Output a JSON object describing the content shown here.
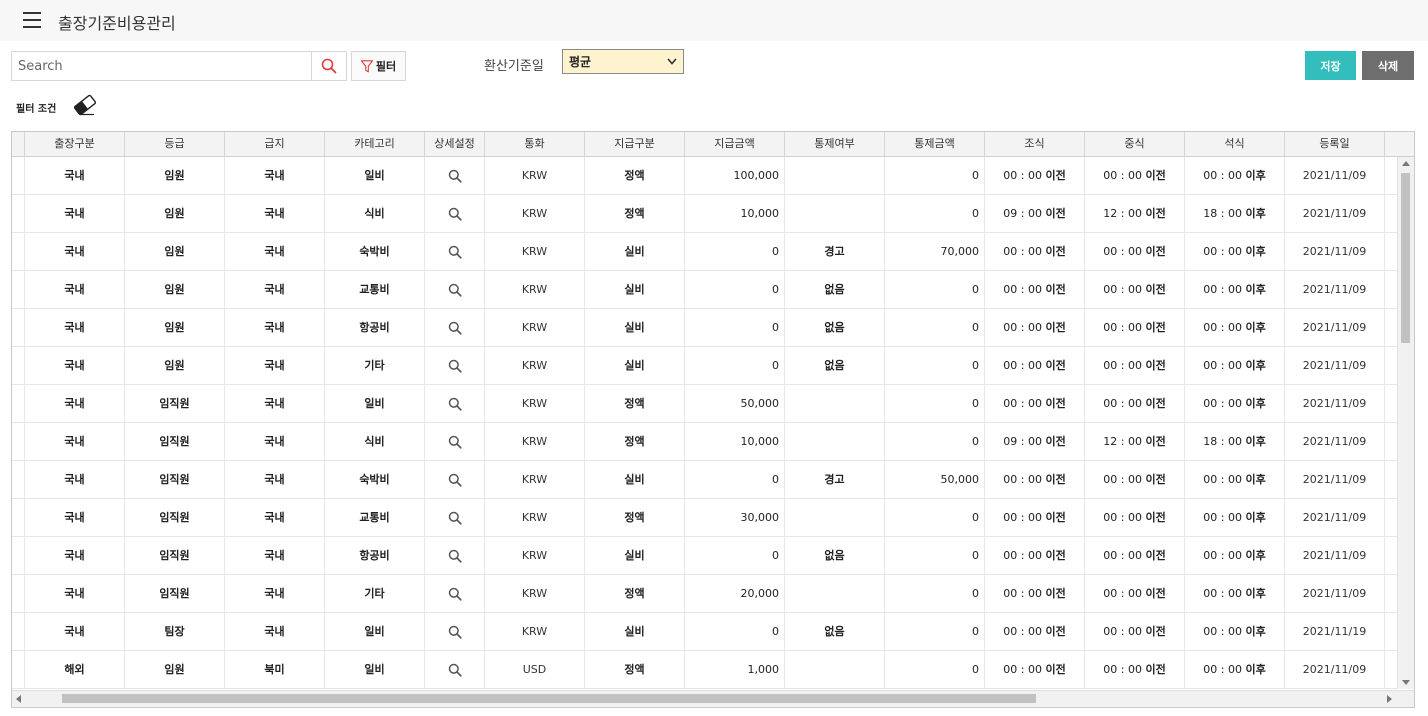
{
  "header": {
    "title": "출장기준비용관리"
  },
  "toolbar": {
    "search_placeholder": "Search",
    "filter_label": "필터",
    "conversion_label": "환산기준일",
    "conversion_value": "평균",
    "save_label": "저장",
    "delete_label": "삭제",
    "filter_condition_label": "필터 조건"
  },
  "colors": {
    "accent": "#34bdbd",
    "delete": "#6e6e6e",
    "select_bg": "#fdf3cf",
    "search_icon": "#e0393e",
    "filter_icon": "#e0393e"
  },
  "icons": {
    "menu": "hamburger-icon",
    "search": "search-icon",
    "filter": "funnel-icon",
    "eraser": "eraser-icon",
    "detail": "magnifier-icon"
  },
  "columns": [
    "출장구분",
    "등급",
    "급지",
    "카테고리",
    "상세설정",
    "통화",
    "지급구분",
    "지급금액",
    "통제여부",
    "통제금액",
    "조식",
    "중식",
    "석식",
    "등록일"
  ],
  "rows": [
    {
      "trip": "국내",
      "grade": "임원",
      "zone": "국내",
      "category": "일비",
      "currency": "KRW",
      "pay_type": "정액",
      "amount": "100,000",
      "control": "",
      "control_amount": "0",
      "breakfast": [
        "00 : 00",
        "이전"
      ],
      "lunch": [
        "00 : 00",
        "이전"
      ],
      "dinner": [
        "00 : 00",
        "이후"
      ],
      "date": "2021/11/09"
    },
    {
      "trip": "국내",
      "grade": "임원",
      "zone": "국내",
      "category": "식비",
      "currency": "KRW",
      "pay_type": "정액",
      "amount": "10,000",
      "control": "",
      "control_amount": "0",
      "breakfast": [
        "09 : 00",
        "이전"
      ],
      "lunch": [
        "12 : 00",
        "이전"
      ],
      "dinner": [
        "18 : 00",
        "이후"
      ],
      "date": "2021/11/09"
    },
    {
      "trip": "국내",
      "grade": "임원",
      "zone": "국내",
      "category": "숙박비",
      "currency": "KRW",
      "pay_type": "실비",
      "amount": "0",
      "control": "경고",
      "control_amount": "70,000",
      "breakfast": [
        "00 : 00",
        "이전"
      ],
      "lunch": [
        "00 : 00",
        "이전"
      ],
      "dinner": [
        "00 : 00",
        "이후"
      ],
      "date": "2021/11/09"
    },
    {
      "trip": "국내",
      "grade": "임원",
      "zone": "국내",
      "category": "교통비",
      "currency": "KRW",
      "pay_type": "실비",
      "amount": "0",
      "control": "없음",
      "control_amount": "0",
      "breakfast": [
        "00 : 00",
        "이전"
      ],
      "lunch": [
        "00 : 00",
        "이전"
      ],
      "dinner": [
        "00 : 00",
        "이후"
      ],
      "date": "2021/11/09"
    },
    {
      "trip": "국내",
      "grade": "임원",
      "zone": "국내",
      "category": "항공비",
      "currency": "KRW",
      "pay_type": "실비",
      "amount": "0",
      "control": "없음",
      "control_amount": "0",
      "breakfast": [
        "00 : 00",
        "이전"
      ],
      "lunch": [
        "00 : 00",
        "이전"
      ],
      "dinner": [
        "00 : 00",
        "이후"
      ],
      "date": "2021/11/09"
    },
    {
      "trip": "국내",
      "grade": "임원",
      "zone": "국내",
      "category": "기타",
      "currency": "KRW",
      "pay_type": "실비",
      "amount": "0",
      "control": "없음",
      "control_amount": "0",
      "breakfast": [
        "00 : 00",
        "이전"
      ],
      "lunch": [
        "00 : 00",
        "이전"
      ],
      "dinner": [
        "00 : 00",
        "이후"
      ],
      "date": "2021/11/09"
    },
    {
      "trip": "국내",
      "grade": "임직원",
      "zone": "국내",
      "category": "일비",
      "currency": "KRW",
      "pay_type": "정액",
      "amount": "50,000",
      "control": "",
      "control_amount": "0",
      "breakfast": [
        "00 : 00",
        "이전"
      ],
      "lunch": [
        "00 : 00",
        "이전"
      ],
      "dinner": [
        "00 : 00",
        "이후"
      ],
      "date": "2021/11/09"
    },
    {
      "trip": "국내",
      "grade": "임직원",
      "zone": "국내",
      "category": "식비",
      "currency": "KRW",
      "pay_type": "정액",
      "amount": "10,000",
      "control": "",
      "control_amount": "0",
      "breakfast": [
        "09 : 00",
        "이전"
      ],
      "lunch": [
        "12 : 00",
        "이전"
      ],
      "dinner": [
        "18 : 00",
        "이후"
      ],
      "date": "2021/11/09"
    },
    {
      "trip": "국내",
      "grade": "임직원",
      "zone": "국내",
      "category": "숙박비",
      "currency": "KRW",
      "pay_type": "실비",
      "amount": "0",
      "control": "경고",
      "control_amount": "50,000",
      "breakfast": [
        "00 : 00",
        "이전"
      ],
      "lunch": [
        "00 : 00",
        "이전"
      ],
      "dinner": [
        "00 : 00",
        "이후"
      ],
      "date": "2021/11/09"
    },
    {
      "trip": "국내",
      "grade": "임직원",
      "zone": "국내",
      "category": "교통비",
      "currency": "KRW",
      "pay_type": "정액",
      "amount": "30,000",
      "control": "",
      "control_amount": "0",
      "breakfast": [
        "00 : 00",
        "이전"
      ],
      "lunch": [
        "00 : 00",
        "이전"
      ],
      "dinner": [
        "00 : 00",
        "이후"
      ],
      "date": "2021/11/09"
    },
    {
      "trip": "국내",
      "grade": "임직원",
      "zone": "국내",
      "category": "항공비",
      "currency": "KRW",
      "pay_type": "실비",
      "amount": "0",
      "control": "없음",
      "control_amount": "0",
      "breakfast": [
        "00 : 00",
        "이전"
      ],
      "lunch": [
        "00 : 00",
        "이전"
      ],
      "dinner": [
        "00 : 00",
        "이후"
      ],
      "date": "2021/11/09"
    },
    {
      "trip": "국내",
      "grade": "임직원",
      "zone": "국내",
      "category": "기타",
      "currency": "KRW",
      "pay_type": "정액",
      "amount": "20,000",
      "control": "",
      "control_amount": "0",
      "breakfast": [
        "00 : 00",
        "이전"
      ],
      "lunch": [
        "00 : 00",
        "이전"
      ],
      "dinner": [
        "00 : 00",
        "이후"
      ],
      "date": "2021/11/09"
    },
    {
      "trip": "국내",
      "grade": "팀장",
      "zone": "국내",
      "category": "일비",
      "currency": "KRW",
      "pay_type": "실비",
      "amount": "0",
      "control": "없음",
      "control_amount": "0",
      "breakfast": [
        "00 : 00",
        "이전"
      ],
      "lunch": [
        "00 : 00",
        "이전"
      ],
      "dinner": [
        "00 : 00",
        "이후"
      ],
      "date": "2021/11/19"
    },
    {
      "trip": "해외",
      "grade": "임원",
      "zone": "북미",
      "category": "일비",
      "currency": "USD",
      "pay_type": "정액",
      "amount": "1,000",
      "control": "",
      "control_amount": "0",
      "breakfast": [
        "00 : 00",
        "이전"
      ],
      "lunch": [
        "00 : 00",
        "이전"
      ],
      "dinner": [
        "00 : 00",
        "이후"
      ],
      "date": "2021/11/09"
    }
  ]
}
